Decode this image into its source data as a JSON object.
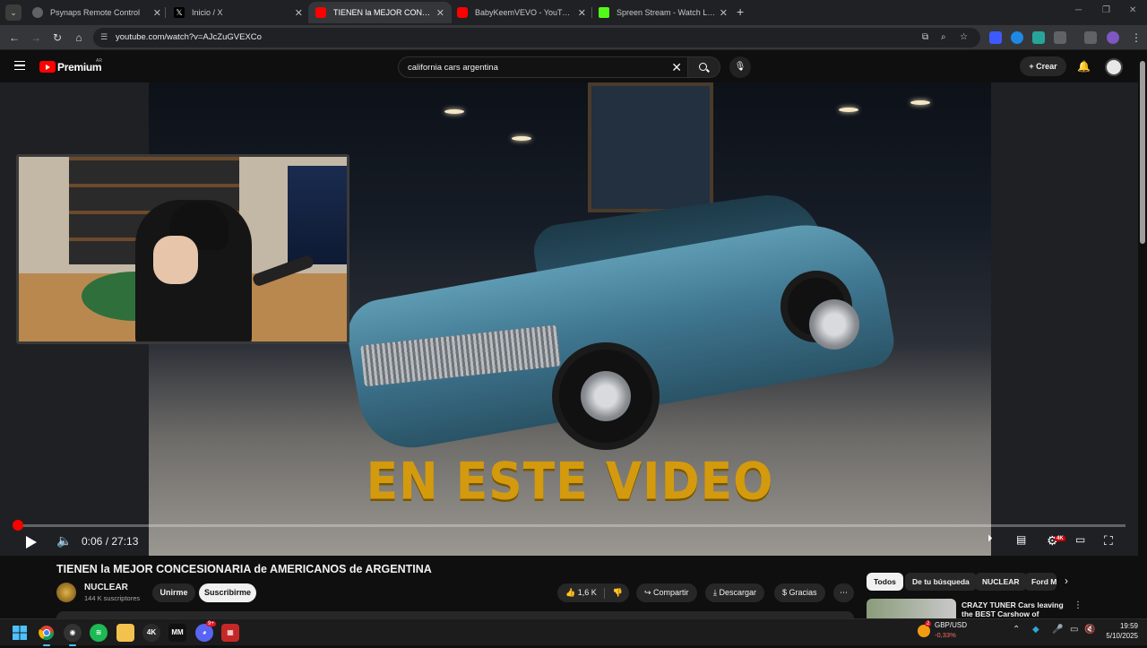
{
  "browser": {
    "tabs": [
      {
        "title": "Psynaps Remote Control",
        "favicon_color": "#5f6368"
      },
      {
        "title": "Inicio / X",
        "favicon_color": "#000000"
      },
      {
        "title": "TIENEN la MEJOR CONCESIONARIA",
        "favicon_color": "#ff0000"
      },
      {
        "title": "BabyKeemVEVO - YouTube",
        "favicon_color": "#ff0000"
      },
      {
        "title": "Spreen Stream - Watch Live on",
        "favicon_color": "#53fc18"
      }
    ],
    "active_tab_index": 2,
    "close_glyph": "✕",
    "new_tab_glyph": "+",
    "url": "youtube.com/watch?v=AJcZuGVEXCo"
  },
  "youtube": {
    "brand": "Premium",
    "country_code": "AR",
    "search_query": "california cars argentina",
    "create_label": "Crear"
  },
  "player": {
    "overlay_caption": "EN ESTE VIDEO",
    "current_time": "0:06",
    "duration": "27:13",
    "time_display": "0:06 / 27:13",
    "progress_fraction": 0.0037,
    "quality_badge": "4K",
    "accent_color": "#ff0000"
  },
  "video": {
    "title": "TIENEN la MEJOR CONCESIONARIA de AMERICANOS de ARGENTINA",
    "channel_name": "NUCLEAR",
    "subscribers": "144 K suscriptores",
    "join_label": "Unirme",
    "subscribe_label": "Suscribirme",
    "likes": "1,6 K",
    "share_label": "Compartir",
    "download_label": "Descargar",
    "thanks_label": "Gracias"
  },
  "recommendations": {
    "chips": [
      "Todos",
      "De tu búsqueda",
      "NUCLEAR",
      "Ford M"
    ],
    "first_title": "CRAZY TUNER Cars leaving the BEST Carshow of EUROPE |"
  },
  "taskbar": {
    "fx_pair": "GBP/USD",
    "fx_change": "-0,33%",
    "time": "19:59",
    "date": "5/10/2025",
    "fx_badge": "2",
    "discord_badge": "9+"
  }
}
